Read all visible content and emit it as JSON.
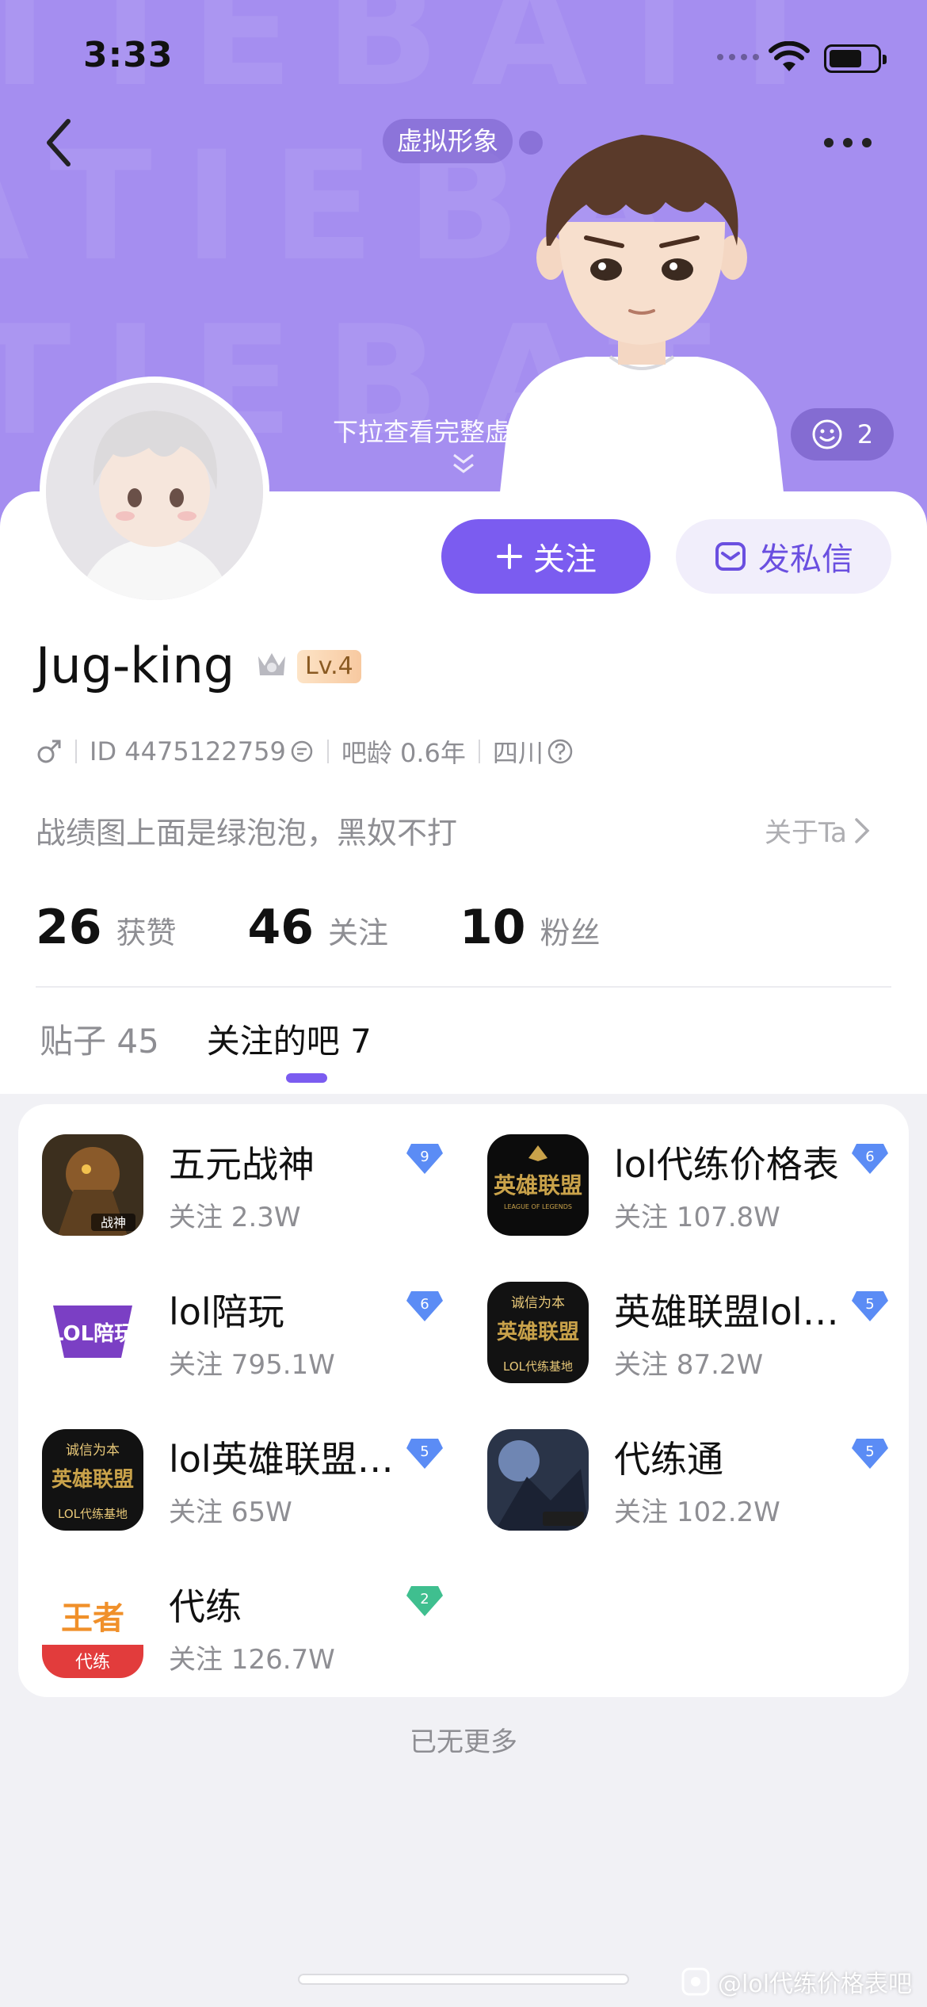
{
  "status_bar": {
    "time": "3:33"
  },
  "header": {
    "avatar_pill": "虚拟形象",
    "pull_hint": "下拉查看完整虚",
    "smile_count": "2"
  },
  "actions": {
    "follow": "关注",
    "message": "发私信"
  },
  "profile": {
    "username": "Jug-king",
    "level": "Lv.4",
    "id_text": "ID 4475122759",
    "bar_age": "吧龄 0.6年",
    "location": "四川",
    "bio": "战绩图上面是绿泡泡，黑奴不打",
    "about": "关于Ta"
  },
  "stats": [
    {
      "num": "26",
      "label": "获赞"
    },
    {
      "num": "46",
      "label": "关注"
    },
    {
      "num": "10",
      "label": "粉丝"
    }
  ],
  "tabs": [
    {
      "label": "贴子 45"
    },
    {
      "label": "关注的吧 7"
    }
  ],
  "forums": [
    {
      "name": "五元战神",
      "follows": "关注 2.3W",
      "level": "9",
      "level_color": "#5b8cf5"
    },
    {
      "name": "lol代练价格表",
      "follows": "关注 107.8W",
      "level": "6",
      "level_color": "#5b8cf5"
    },
    {
      "name": "lol陪玩",
      "follows": "关注 795.1W",
      "level": "6",
      "level_color": "#5b8cf5"
    },
    {
      "name": "英雄联盟lol…",
      "follows": "关注 87.2W",
      "level": "5",
      "level_color": "#5b8cf5"
    },
    {
      "name": "lol英雄联盟…",
      "follows": "关注 65W",
      "level": "5",
      "level_color": "#5b8cf5"
    },
    {
      "name": "代练通",
      "follows": "关注 102.2W",
      "level": "5",
      "level_color": "#5b8cf5"
    },
    {
      "name": "代练",
      "follows": "关注 126.7W",
      "level": "2",
      "level_color": "#3fbf8f"
    }
  ],
  "forum_icon_texts": {
    "wuyuan": "战神",
    "lolpw": "LOL陪玩",
    "yxlm": "英雄联盟",
    "league": "LEAGUE OF LEGENDS",
    "chengxin": "诚信为本",
    "lol_dlj": "LOL代练基地",
    "wangzhe": "王者",
    "dailian": "代练"
  },
  "footer": {
    "no_more": "已无更多",
    "watermark": "@lol代练价格表吧"
  },
  "colors": {
    "header_bg": "#a58ef0",
    "accent": "#7b5cf0"
  }
}
